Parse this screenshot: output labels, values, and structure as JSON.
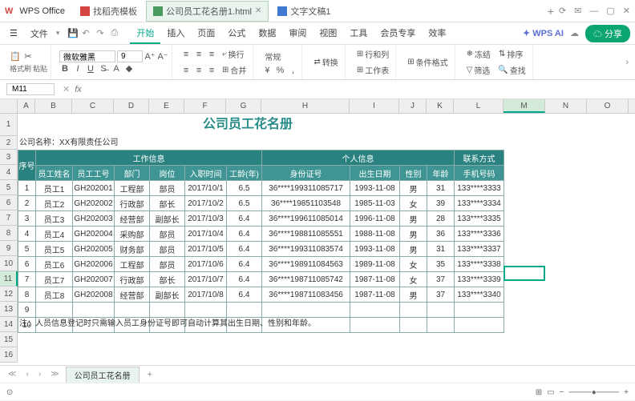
{
  "titlebar": {
    "logo": "W",
    "appname": "WPS Office",
    "tabs": [
      {
        "icon": "red",
        "label": "找稻壳模板"
      },
      {
        "icon": "green",
        "label": "公司员工花名册1.html",
        "active": true
      },
      {
        "icon": "blue",
        "label": "文字文稿1"
      }
    ]
  },
  "menubar": {
    "file": "文件",
    "items": [
      "开始",
      "插入",
      "页面",
      "公式",
      "数据",
      "审阅",
      "视图",
      "工具",
      "会员专享",
      "效率"
    ],
    "active": 0,
    "wpsai": "WPS AI",
    "share": "分享"
  },
  "toolbar": {
    "clipboard_label": "格式刷",
    "paste_label": "粘贴",
    "font": "微软雅黑",
    "size": "9",
    "wrap": "换行",
    "merge": "合并",
    "numfmt": "常规",
    "convert": "转换",
    "rowcol": "行和列",
    "worksheet": "工作表",
    "condfmt": "条件格式",
    "freeze": "冻结",
    "sort": "排序",
    "filter": "筛选",
    "find": "查找"
  },
  "namebox": {
    "cell": "M11",
    "fx": "fx"
  },
  "sheet": {
    "cols": [
      "A",
      "B",
      "C",
      "D",
      "E",
      "F",
      "G",
      "H",
      "I",
      "J",
      "K",
      "L",
      "M",
      "N",
      "O"
    ],
    "sel_col": "M",
    "sel_row": 11,
    "title": "公司员工花名册",
    "company": "公司名称：XX有限责任公司",
    "headers": {
      "seq": "序号",
      "work": "工作信息",
      "personal": "个人信息",
      "contact": "联系方式",
      "name": "员工姓名",
      "id": "员工工号",
      "dept": "部门",
      "pos": "岗位",
      "hiredate": "入职时间",
      "years": "工龄(年)",
      "idcard": "身份证号",
      "dob": "出生日期",
      "gender": "性别",
      "age": "年龄",
      "phone": "手机号码"
    },
    "rows": [
      {
        "n": "1",
        "name": "员工1",
        "id": "GH202001",
        "dept": "工程部",
        "pos": "部员",
        "hire": "2017/10/1",
        "yr": "6.5",
        "idc": "36****199311085717",
        "dob": "1993-11-08",
        "g": "男",
        "age": "31",
        "ph": "133****3333"
      },
      {
        "n": "2",
        "name": "员工2",
        "id": "GH202002",
        "dept": "行政部",
        "pos": "部长",
        "hire": "2017/10/2",
        "yr": "6.5",
        "idc": "36****19851103548",
        "dob": "1985-11-03",
        "g": "女",
        "age": "39",
        "ph": "133****3334"
      },
      {
        "n": "3",
        "name": "员工3",
        "id": "GH202003",
        "dept": "经营部",
        "pos": "副部长",
        "hire": "2017/10/3",
        "yr": "6.4",
        "idc": "36****199611085014",
        "dob": "1996-11-08",
        "g": "男",
        "age": "28",
        "ph": "133****3335"
      },
      {
        "n": "4",
        "name": "员工4",
        "id": "GH202004",
        "dept": "采购部",
        "pos": "部员",
        "hire": "2017/10/4",
        "yr": "6.4",
        "idc": "36****198811085551",
        "dob": "1988-11-08",
        "g": "男",
        "age": "36",
        "ph": "133****3336"
      },
      {
        "n": "5",
        "name": "员工5",
        "id": "GH202005",
        "dept": "财务部",
        "pos": "部员",
        "hire": "2017/10/5",
        "yr": "6.4",
        "idc": "36****199311083574",
        "dob": "1993-11-08",
        "g": "男",
        "age": "31",
        "ph": "133****3337"
      },
      {
        "n": "6",
        "name": "员工6",
        "id": "GH202006",
        "dept": "工程部",
        "pos": "部员",
        "hire": "2017/10/6",
        "yr": "6.4",
        "idc": "36****198911084563",
        "dob": "1989-11-08",
        "g": "女",
        "age": "35",
        "ph": "133****3338"
      },
      {
        "n": "7",
        "name": "员工7",
        "id": "GH202007",
        "dept": "行政部",
        "pos": "部长",
        "hire": "2017/10/7",
        "yr": "6.4",
        "idc": "36****198711085742",
        "dob": "1987-11-08",
        "g": "女",
        "age": "37",
        "ph": "133****3339"
      },
      {
        "n": "8",
        "name": "员工8",
        "id": "GH202008",
        "dept": "经营部",
        "pos": "副部长",
        "hire": "2017/10/8",
        "yr": "6.4",
        "idc": "36****198711083456",
        "dob": "1987-11-08",
        "g": "男",
        "age": "37",
        "ph": "133****3340"
      }
    ],
    "empty_rows": [
      "9",
      "10"
    ],
    "note": "注：人员信息登记时只需输入员工身份证号即可自动计算其出生日期、性别和年龄。",
    "sheet_tab": "公司员工花名册"
  }
}
